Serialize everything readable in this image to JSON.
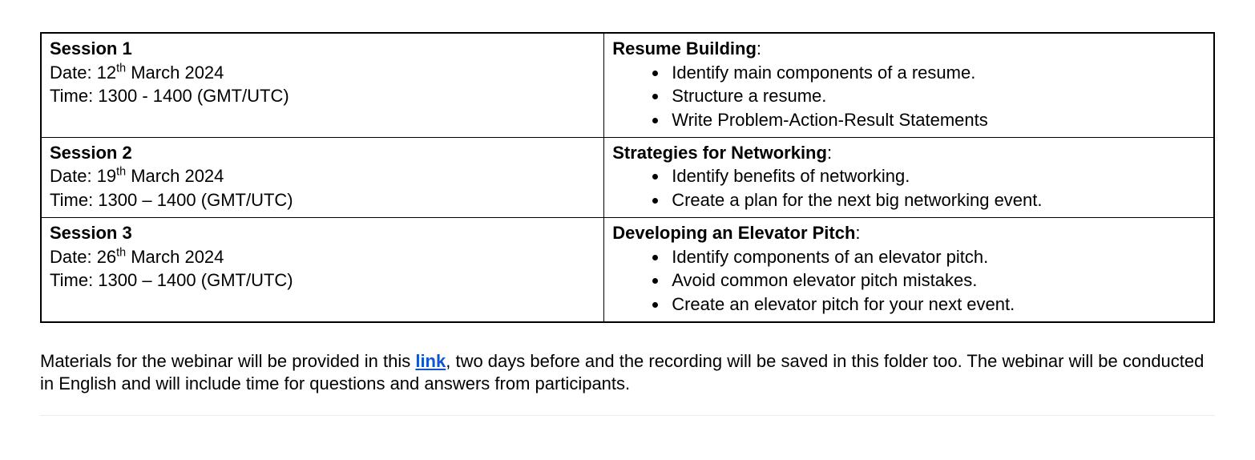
{
  "sessions": [
    {
      "title": "Session 1",
      "date_prefix": "Date: 12",
      "date_ord": "th",
      "date_suffix": " March 2024",
      "time": "Time: 1300 - 1400 (GMT/UTC)",
      "topic_heading": "Resume Building",
      "bullets": [
        "Identify main components of a resume.",
        "Structure a resume.",
        "Write Problem-Action-Result Statements"
      ]
    },
    {
      "title": "Session 2",
      "date_prefix": "Date: 19",
      "date_ord": "th",
      "date_suffix": " March 2024",
      "time": "Time: 1300 – 1400 (GMT/UTC)",
      "topic_heading": "Strategies for Networking",
      "bullets": [
        "Identify benefits of networking.",
        "Create a plan for the next big networking event."
      ]
    },
    {
      "title": "Session 3",
      "date_prefix": "Date: 26",
      "date_ord": "th",
      "date_suffix": " March 2024",
      "time": "Time: 1300 – 1400 (GMT/UTC)",
      "topic_heading": "Developing an Elevator Pitch",
      "bullets": [
        "Identify components of an elevator pitch.",
        "Avoid common elevator pitch mistakes.",
        "Create an elevator pitch for your next event."
      ]
    }
  ],
  "footer": {
    "before_link": "Materials for the webinar will be provided in this ",
    "link_text": "link",
    "after_link": ", two days before and the recording will be saved in this folder too. The webinar will be conducted in English and will include time for questions and answers from participants."
  }
}
